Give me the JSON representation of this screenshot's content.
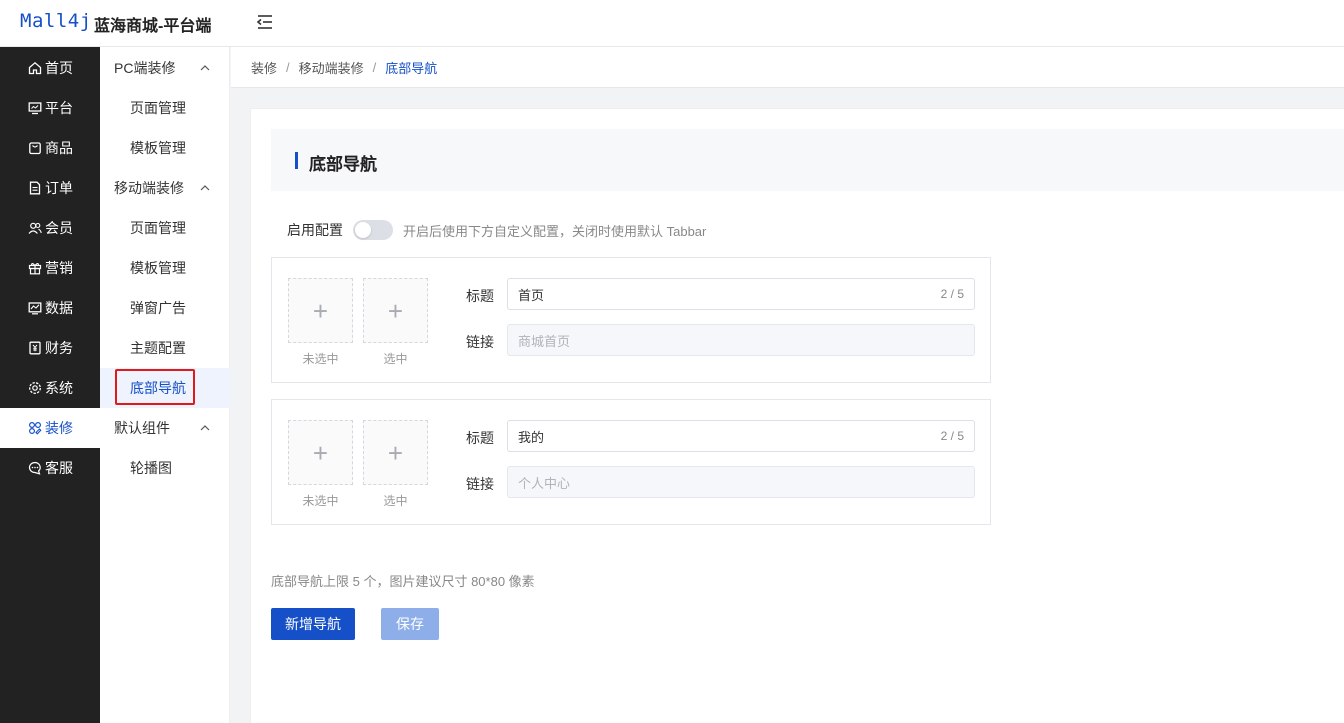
{
  "header": {
    "logo": "Mall4j",
    "title": "蓝海商城-平台端"
  },
  "sidebar": {
    "items": [
      {
        "label": "首页",
        "icon": "home-icon"
      },
      {
        "label": "平台",
        "icon": "monitor-icon"
      },
      {
        "label": "商品",
        "icon": "bag-icon"
      },
      {
        "label": "订单",
        "icon": "document-icon"
      },
      {
        "label": "会员",
        "icon": "users-icon"
      },
      {
        "label": "营销",
        "icon": "gift-icon"
      },
      {
        "label": "数据",
        "icon": "chart-icon"
      },
      {
        "label": "财务",
        "icon": "finance-icon"
      },
      {
        "label": "系统",
        "icon": "gear-icon"
      },
      {
        "label": "装修",
        "icon": "decoration-icon",
        "active": true
      },
      {
        "label": "客服",
        "icon": "chat-icon"
      }
    ]
  },
  "subsidebar": {
    "groups": [
      {
        "label": "PC端装修",
        "items": [
          "页面管理",
          "模板管理"
        ]
      },
      {
        "label": "移动端装修",
        "items": [
          "页面管理",
          "模板管理",
          "弹窗广告",
          "主题配置",
          "底部导航"
        ]
      },
      {
        "label": "默认组件",
        "items": [
          "轮播图"
        ]
      }
    ],
    "active_item": "底部导航"
  },
  "breadcrumb": [
    "装修",
    "移动端装修",
    "底部导航"
  ],
  "page": {
    "title": "底部导航",
    "enable_label": "启用配置",
    "enabled": false,
    "enable_hint": "开启后使用下方自定义配置，关闭时使用默认 Tabbar",
    "unselected_label": "未选中",
    "selected_label": "选中",
    "title_field_label": "标题",
    "link_field_label": "链接",
    "nav_items": [
      {
        "title": "首页",
        "count": "2 / 5",
        "link_placeholder": "商城首页"
      },
      {
        "title": "我的",
        "count": "2 / 5",
        "link_placeholder": "个人中心"
      }
    ],
    "footer_hint": "底部导航上限 5 个，图片建议尺寸 80*80 像素",
    "add_button": "新增导航",
    "save_button": "保存"
  },
  "colors": {
    "primary": "#1550c8",
    "sidebar_bg": "#222222",
    "highlight_border": "#e01a1a"
  }
}
